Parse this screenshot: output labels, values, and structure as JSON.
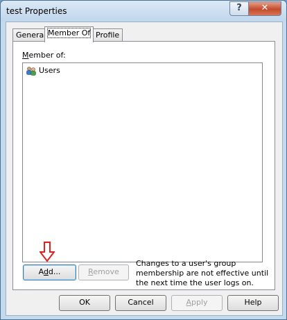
{
  "window": {
    "title": "test Properties",
    "help_glyph": "?",
    "close_glyph": "✕"
  },
  "tabs": [
    {
      "label": "General"
    },
    {
      "label": "Member Of"
    },
    {
      "label": "Profile"
    }
  ],
  "members": {
    "label": "Member of:",
    "items": [
      {
        "name": "Users",
        "icon": "users-group-icon"
      }
    ]
  },
  "buttons": {
    "add": {
      "pre": "A",
      "accel": "d",
      "post": "d..."
    },
    "remove": {
      "accel": "R",
      "post": "emove"
    },
    "ok": "OK",
    "cancel": "Cancel",
    "apply": {
      "accel": "A",
      "post": "pply"
    },
    "help": "Help"
  },
  "note": "Changes to a user's group membership are not effective until the next time the user logs on.",
  "annotation": {
    "arrow_color": "#e02020"
  },
  "colors": {
    "accent": "#3c7fb1",
    "close": "#c44b2d"
  }
}
